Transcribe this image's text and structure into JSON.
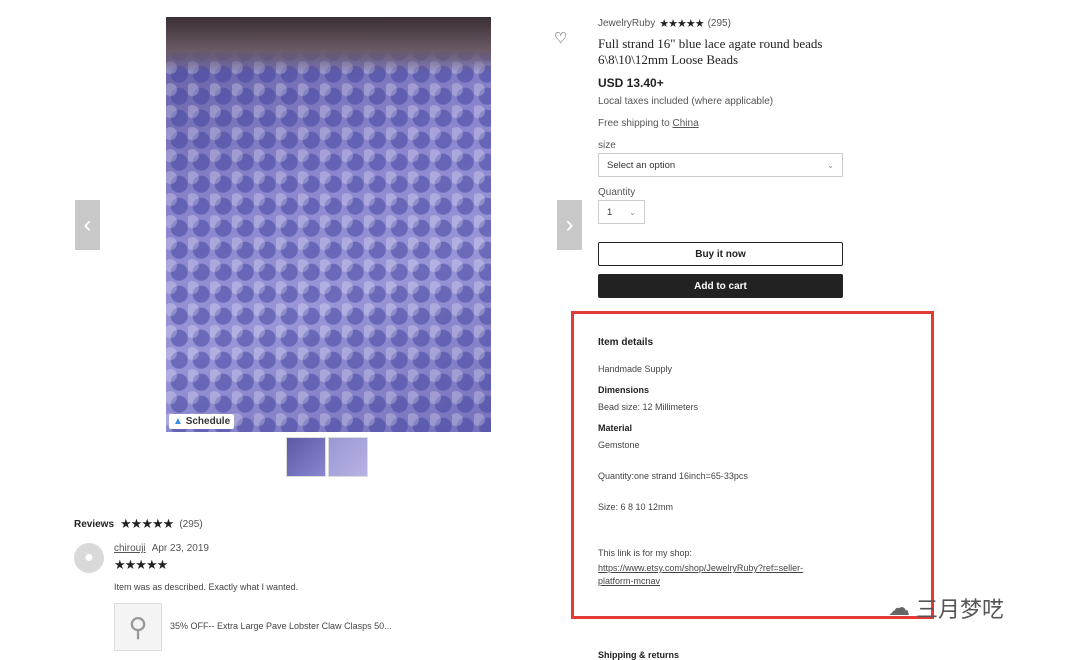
{
  "gallery": {
    "schedule_label": "Schedule",
    "prev_icon": "chevron-left-icon",
    "next_icon": "chevron-right-icon",
    "thumbnails": [
      "thumbnail-1",
      "thumbnail-2"
    ]
  },
  "listing": {
    "shop_name": "JewelryRuby",
    "shop_stars": "★★★★★",
    "shop_review_count": "(295)",
    "title_line1": "Full strand 16\" blue lace agate round beads",
    "title_line2": "6\\8\\10\\12mm Loose Beads",
    "price": "USD 13.40+",
    "tax_note": "Local taxes included (where applicable)",
    "shipping_prefix": "Free shipping to ",
    "shipping_country": "China",
    "size_label": "size",
    "size_placeholder": "Select an option",
    "quantity_label": "Quantity",
    "quantity_value": "1",
    "buy_now_label": "Buy it now",
    "add_to_cart_label": "Add to cart"
  },
  "item_details": {
    "heading": "Item details",
    "type": "Handmade Supply",
    "dimensions_label": "Dimensions",
    "dimensions_value": "Bead size: 12 Millimeters",
    "material_label": "Material",
    "material_value": "Gemstone",
    "quantity_line": "Quantity:one strand 16inch=65-33pcs",
    "size_line": "Size: 6 8 10 12mm",
    "shop_link_intro": "This link is for my shop:",
    "shop_url_line1": "https://www.etsy.com/shop/JewelryRuby?ref=seller-",
    "shop_url_line2": "platform-mcnav"
  },
  "shipping_heading": "Shipping & returns",
  "reviews": {
    "heading": "Reviews",
    "stars": "★★★★★",
    "count": "(295)",
    "items": [
      {
        "user": "chirouji",
        "date": "Apr 23, 2019",
        "stars": "★★★★★",
        "text": "Item was as described. Exactly what I wanted.",
        "product": "35% OFF-- Extra Large Pave Lobster Claw Clasps 50..."
      }
    ]
  },
  "watermark": {
    "text": "三月梦呓"
  },
  "colors": {
    "highlight": "#e53935",
    "button_dark": "#222222",
    "bead_blue": "#8b86cf"
  }
}
